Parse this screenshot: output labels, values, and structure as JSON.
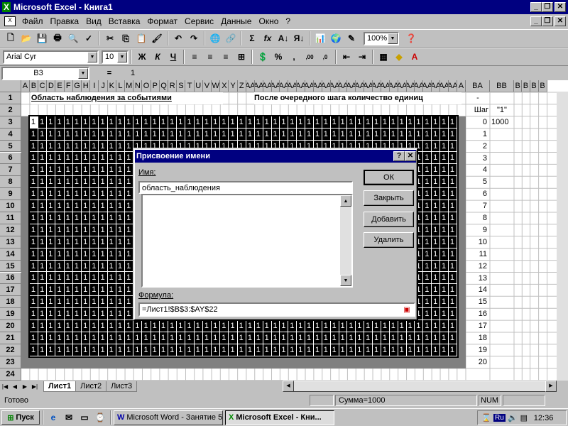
{
  "window": {
    "title": "Microsoft Excel - Книга1"
  },
  "menu": [
    "Файл",
    "Правка",
    "Вид",
    "Вставка",
    "Формат",
    "Сервис",
    "Данные",
    "Окно",
    "?"
  ],
  "format_bar": {
    "font": "Arial Cyr",
    "size": "10"
  },
  "standard_bar": {
    "zoom": "100%"
  },
  "formula_bar": {
    "name_box": "B3",
    "equals": "=",
    "value": "1"
  },
  "columns": [
    "A",
    "B",
    "C",
    "D",
    "E",
    "F",
    "G",
    "H",
    "I",
    "J",
    "K",
    "L",
    "M",
    "N",
    "O",
    "P",
    "Q",
    "R",
    "S",
    "T",
    "U",
    "V",
    "W",
    "X",
    "Y",
    "Z",
    "AA",
    "AA",
    "AA",
    "AA",
    "AA",
    "AA",
    "AA",
    "AA",
    "AA",
    "AA",
    "AA",
    "AA",
    "AA",
    "AA",
    "AA",
    "AA",
    "AA",
    "AA",
    "AA",
    "AA",
    "AA",
    "AA",
    "AA",
    "AA",
    "AA",
    "A",
    "BA",
    "BB",
    "B",
    "B",
    "B",
    "B"
  ],
  "rows": [
    "1",
    "2",
    "3",
    "4",
    "5",
    "6",
    "7",
    "8",
    "9",
    "10",
    "11",
    "12",
    "13",
    "14",
    "15",
    "16",
    "17",
    "18",
    "19",
    "20",
    "21",
    "22",
    "23",
    "24"
  ],
  "cells": {
    "title_left": "Область наблюдения за событиями",
    "title_right": "После очередного шага количество единиц",
    "ba1": "-",
    "ba2": "Шаг",
    "bb2": "\"1\"",
    "bb3": "1000",
    "fill": "1",
    "steps": [
      "0",
      "1",
      "2",
      "3",
      "4",
      "5",
      "6",
      "7",
      "8",
      "9",
      "10",
      "11",
      "12",
      "13",
      "14",
      "15",
      "16",
      "17",
      "18",
      "19",
      "20"
    ]
  },
  "dialog": {
    "title": "Присвоение имени",
    "name_label": "Имя:",
    "name_value": "область_наблюдения",
    "formula_label": "Формула:",
    "formula_value": "=Лист1!$B$3:$AY$22",
    "ok": "ОК",
    "close": "Закрыть",
    "add": "Добавить",
    "delete": "Удалить",
    "help": "?",
    "x": "✕"
  },
  "sheets": [
    "Лист1",
    "Лист2",
    "Лист3"
  ],
  "status": {
    "ready": "Готово",
    "sum": "Сумма=1000",
    "num": "NUM"
  },
  "taskbar": {
    "start": "Пуск",
    "word": "Microsoft Word - Занятие 5",
    "excel": "Microsoft Excel - Кни...",
    "lang": "Ru",
    "time": "12:36"
  },
  "colors": {
    "title_bar": "#000080",
    "selection_black": "#000000",
    "face": "#c0c0c0"
  }
}
